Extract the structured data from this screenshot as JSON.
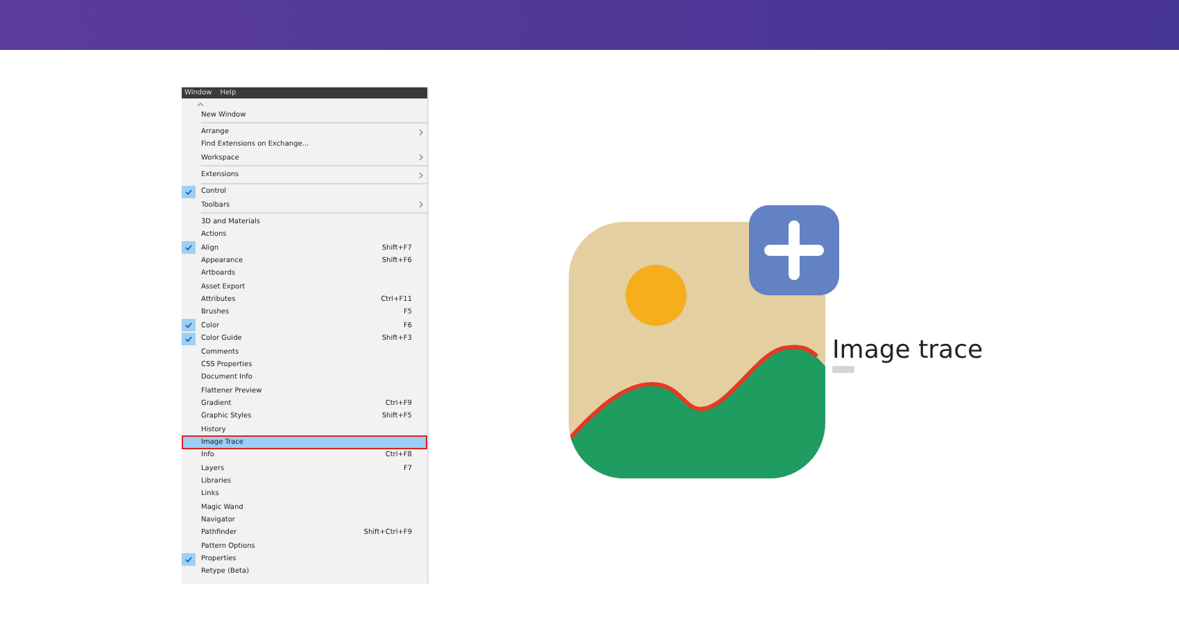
{
  "menu": {
    "titles": [
      "Window",
      "Help"
    ],
    "items": [
      {
        "kind": "item",
        "label": "New Window",
        "checked": false,
        "selected": false
      },
      {
        "kind": "divider"
      },
      {
        "kind": "item",
        "label": "Arrange",
        "checked": false,
        "selected": false,
        "submenu": true
      },
      {
        "kind": "item",
        "label": "Find Extensions on Exchange...",
        "checked": false,
        "selected": false
      },
      {
        "kind": "item",
        "label": "Workspace",
        "checked": false,
        "selected": false,
        "submenu": true
      },
      {
        "kind": "divider"
      },
      {
        "kind": "item",
        "label": "Extensions",
        "checked": false,
        "selected": false,
        "submenu": true
      },
      {
        "kind": "divider"
      },
      {
        "kind": "item",
        "label": "Control",
        "checked": true,
        "selected": false
      },
      {
        "kind": "item",
        "label": "Toolbars",
        "checked": false,
        "selected": false,
        "submenu": true
      },
      {
        "kind": "divider"
      },
      {
        "kind": "item",
        "label": "3D and Materials",
        "checked": false,
        "selected": false
      },
      {
        "kind": "item",
        "label": "Actions",
        "checked": false,
        "selected": false
      },
      {
        "kind": "item",
        "label": "Align",
        "checked": true,
        "selected": false,
        "shortcut": "Shift+F7"
      },
      {
        "kind": "item",
        "label": "Appearance",
        "checked": false,
        "selected": false,
        "shortcut": "Shift+F6"
      },
      {
        "kind": "item",
        "label": "Artboards",
        "checked": false,
        "selected": false
      },
      {
        "kind": "item",
        "label": "Asset Export",
        "checked": false,
        "selected": false
      },
      {
        "kind": "item",
        "label": "Attributes",
        "checked": false,
        "selected": false,
        "shortcut": "Ctrl+F11"
      },
      {
        "kind": "item",
        "label": "Brushes",
        "checked": false,
        "selected": false,
        "shortcut": "F5"
      },
      {
        "kind": "item",
        "label": "Color",
        "checked": true,
        "selected": false,
        "shortcut": "F6"
      },
      {
        "kind": "item",
        "label": "Color Guide",
        "checked": true,
        "selected": false,
        "shortcut": "Shift+F3"
      },
      {
        "kind": "item",
        "label": "Comments",
        "checked": false,
        "selected": false
      },
      {
        "kind": "item",
        "label": "CSS Properties",
        "checked": false,
        "selected": false
      },
      {
        "kind": "item",
        "label": "Document Info",
        "checked": false,
        "selected": false
      },
      {
        "kind": "item",
        "label": "Flattener Preview",
        "checked": false,
        "selected": false
      },
      {
        "kind": "item",
        "label": "Gradient",
        "checked": false,
        "selected": false,
        "shortcut": "Ctrl+F9"
      },
      {
        "kind": "item",
        "label": "Graphic Styles",
        "checked": false,
        "selected": false,
        "shortcut": "Shift+F5"
      },
      {
        "kind": "item",
        "label": "History",
        "checked": false,
        "selected": false
      },
      {
        "kind": "item",
        "label": "Image Trace",
        "checked": false,
        "selected": true
      },
      {
        "kind": "item",
        "label": "Info",
        "checked": false,
        "selected": false,
        "shortcut": "Ctrl+F8"
      },
      {
        "kind": "item",
        "label": "Layers",
        "checked": false,
        "selected": false,
        "shortcut": "F7"
      },
      {
        "kind": "item",
        "label": "Libraries",
        "checked": false,
        "selected": false
      },
      {
        "kind": "item",
        "label": "Links",
        "checked": false,
        "selected": false
      },
      {
        "kind": "item",
        "label": "Magic Wand",
        "checked": false,
        "selected": false
      },
      {
        "kind": "item",
        "label": "Navigator",
        "checked": false,
        "selected": false
      },
      {
        "kind": "item",
        "label": "Pathfinder",
        "checked": false,
        "selected": false,
        "shortcut": "Shift+Ctrl+F9"
      },
      {
        "kind": "item",
        "label": "Pattern Options",
        "checked": false,
        "selected": false
      },
      {
        "kind": "item",
        "label": "Properties",
        "checked": true,
        "selected": false
      },
      {
        "kind": "item",
        "label": "Retype (Beta)",
        "checked": false,
        "selected": false
      }
    ]
  },
  "illustration": {
    "caption": "Image trace"
  }
}
